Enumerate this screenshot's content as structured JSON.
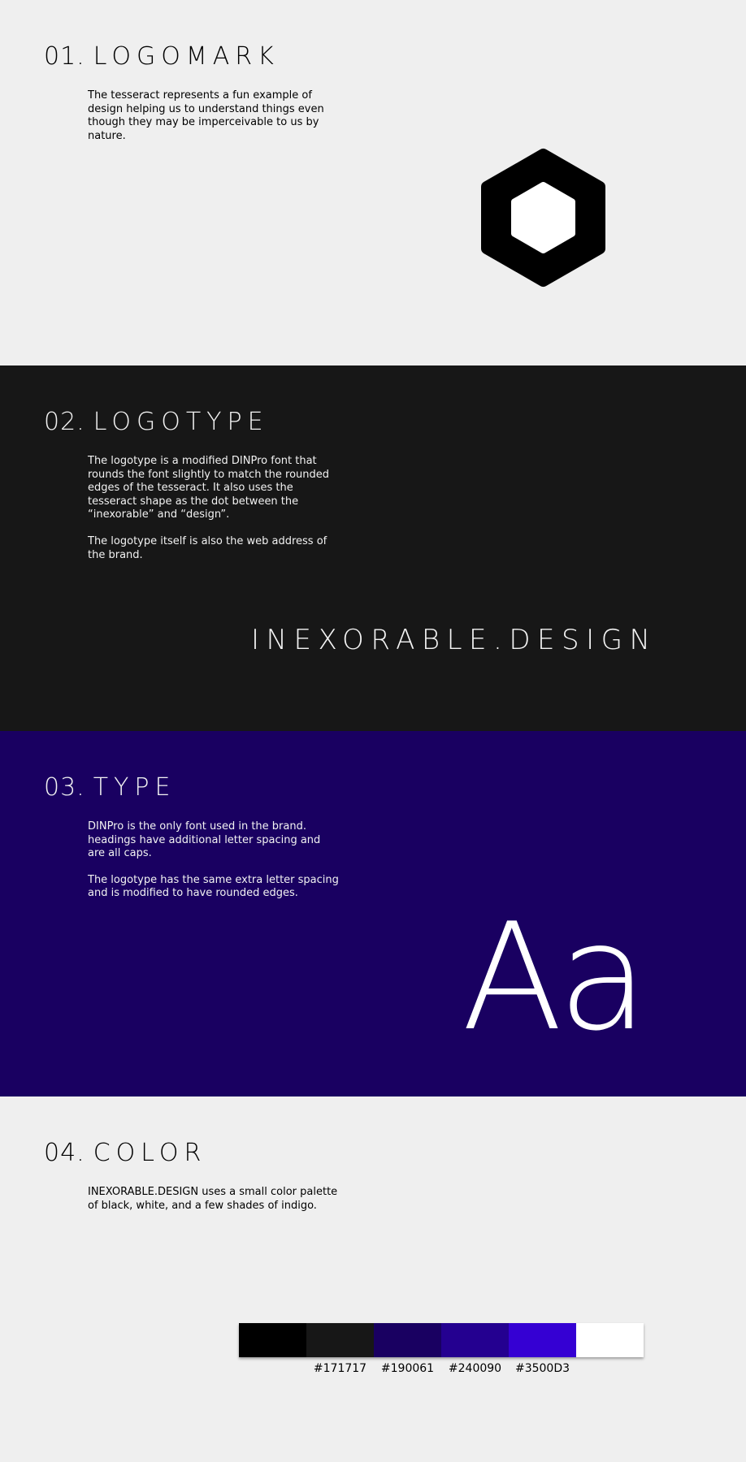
{
  "logomark": {
    "number": "01.",
    "title": "LOGOMARK",
    "paragraphs": [
      "The tesseract represents a fun example of design helping us to understand things even though they may be imperceivable to us by nature."
    ],
    "icon": "tesseract-hexagon-icon"
  },
  "logotype": {
    "number": "02.",
    "title": "LOGOTYPE",
    "paragraphs": [
      "The logotype is a modified DINPro font that rounds the font slightly to match the rounded edges of the tesseract. It also uses the tesseract shape as the dot between the “inexorable” and “design”.",
      "The logotype itself is also the web address of the brand."
    ],
    "wordmark": "INEXORABLE.DESIGN"
  },
  "type": {
    "number": "03.",
    "title": "TYPE",
    "paragraphs": [
      "DINPro is the only font used in the brand. headings have additional letter spacing and are all caps.",
      "The logotype has the same extra letter spacing and is modified to have rounded edges."
    ],
    "specimen_upper": "A",
    "specimen_lower": "a"
  },
  "color": {
    "number": "04.",
    "title": "COLOR",
    "paragraphs": [
      "INEXORABLE.DESIGN uses a small color palette of black, white, and a few shades of indigo."
    ],
    "swatches": [
      "#000000",
      "#171717",
      "#190061",
      "#240090",
      "#3500D3",
      "#FFFFFF"
    ],
    "labels": [
      "#171717",
      "#190061",
      "#240090",
      "#3500D3"
    ]
  },
  "colors": {
    "section1_bg": "#EFEFEF",
    "section2_bg": "#171717",
    "section3_bg": "#190061",
    "section4_bg": "#EFEFEF"
  }
}
